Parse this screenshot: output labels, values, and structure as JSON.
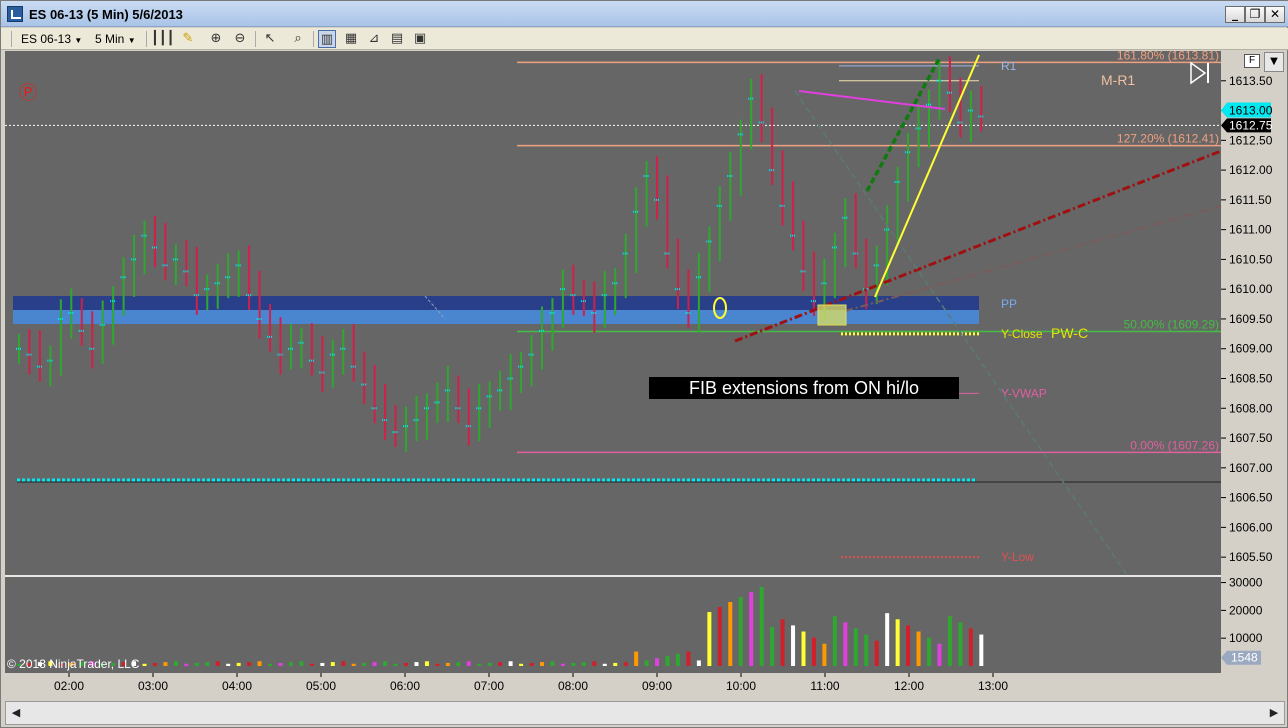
{
  "window": {
    "title": "ES 06-13 (5 Min)  5/6/2013",
    "minimize": "_",
    "restore": "❐",
    "close": "✕"
  },
  "toolbar": {
    "instrument": "ES 06-13",
    "interval": "5 Min"
  },
  "icons": {
    "bars": "bars-icon",
    "pencil": "pencil-icon",
    "zoom_in": "zoom-in-icon",
    "zoom_out": "zoom-out-icon",
    "cursor": "cursor-icon",
    "data_box": "data-box-icon"
  },
  "colors": {
    "background": "#666666",
    "up_bar": "#2fa82f",
    "down_bar": "#d0204a",
    "fib": "#f0a080",
    "pivot_zone": "#5b8fd6",
    "cyan": "#00e8f0",
    "yellow": "#ffff33",
    "magenta": "#e040e0"
  },
  "chart_data": {
    "type": "bar",
    "instrument": "ES 06-13",
    "interval": "5 Min",
    "date": "5/6/2013",
    "price_axis": {
      "ticks": [
        "1613.50",
        "1613.00",
        "1612.50",
        "1612.00",
        "1611.50",
        "1611.00",
        "1610.50",
        "1610.00",
        "1609.50",
        "1609.00",
        "1608.50",
        "1608.00",
        "1607.50",
        "1607.00",
        "1606.50",
        "1606.00",
        "1605.50"
      ],
      "range": [
        1605.2,
        1614.0
      ]
    },
    "time_axis": {
      "ticks": [
        "02:00",
        "03:00",
        "04:00",
        "05:00",
        "06:00",
        "07:00",
        "08:00",
        "09:00",
        "10:00",
        "11:00",
        "12:00",
        "13:00"
      ]
    },
    "price_markers": {
      "last": "1613.00",
      "current": "1612.75"
    },
    "levels": [
      {
        "label": "161.80% (1613.81)",
        "price": 1613.81,
        "color": "#f0a080"
      },
      {
        "label": "127.20% (1612.41)",
        "price": 1612.41,
        "color": "#f0a080"
      },
      {
        "label": "50.00% (1609.29)",
        "price": 1609.29,
        "color": "#44bb44"
      },
      {
        "label": "0.00% (1607.26)",
        "price": 1607.26,
        "color": "#e060a0"
      }
    ],
    "pivot_labels": [
      {
        "label": "R1",
        "price": 1613.75,
        "color": "#9bb8e8"
      },
      {
        "label": "M-R1",
        "price": 1613.5,
        "color": "#f0c0a0"
      },
      {
        "label": "PP",
        "price": 1609.75,
        "color": "#7aaaf0"
      },
      {
        "label": "Y-Close",
        "price": 1609.25,
        "color": "#e6e600"
      },
      {
        "label": "PW-C",
        "price": 1609.25,
        "color": "#e6e600"
      },
      {
        "label": "Y-VWAP",
        "price": 1608.25,
        "color": "#e060a0"
      },
      {
        "label": "Y-Low",
        "price": 1605.5,
        "color": "#e05050"
      }
    ],
    "annotation": "FIB extensions from ON hi/lo",
    "volume_axis": {
      "ticks": [
        "30000",
        "20000",
        "10000"
      ],
      "current": "1548"
    },
    "copyright": "© 2013 NinjaTrader, LLC",
    "logo_glyph": "Ⓟ",
    "close_series": [
      1609.0,
      1608.9,
      1608.7,
      1608.8,
      1609.5,
      1609.6,
      1609.3,
      1609.0,
      1609.4,
      1609.8,
      1610.2,
      1610.5,
      1610.9,
      1610.7,
      1610.4,
      1610.5,
      1610.3,
      1609.9,
      1610.0,
      1610.1,
      1610.2,
      1610.4,
      1609.9,
      1609.5,
      1609.2,
      1608.9,
      1609.0,
      1609.1,
      1608.8,
      1608.6,
      1608.9,
      1609.0,
      1608.7,
      1608.4,
      1608.0,
      1607.8,
      1607.6,
      1607.7,
      1607.8,
      1608.0,
      1608.1,
      1608.3,
      1608.0,
      1607.7,
      1608.0,
      1608.2,
      1608.3,
      1608.5,
      1608.7,
      1608.9,
      1609.3,
      1609.6,
      1610.0,
      1609.9,
      1609.8,
      1609.6,
      1609.9,
      1610.1,
      1610.6,
      1611.3,
      1611.9,
      1611.5,
      1610.6,
      1610.0,
      1609.6,
      1610.2,
      1610.8,
      1611.4,
      1611.9,
      1612.6,
      1613.2,
      1612.8,
      1612.0,
      1611.4,
      1610.9,
      1610.3,
      1609.8,
      1610.1,
      1610.7,
      1611.2,
      1610.6,
      1610.0,
      1610.4,
      1611.0,
      1611.8,
      1612.3,
      1612.7,
      1613.1,
      1613.5,
      1613.3,
      1612.8,
      1613.0,
      1612.9
    ]
  }
}
